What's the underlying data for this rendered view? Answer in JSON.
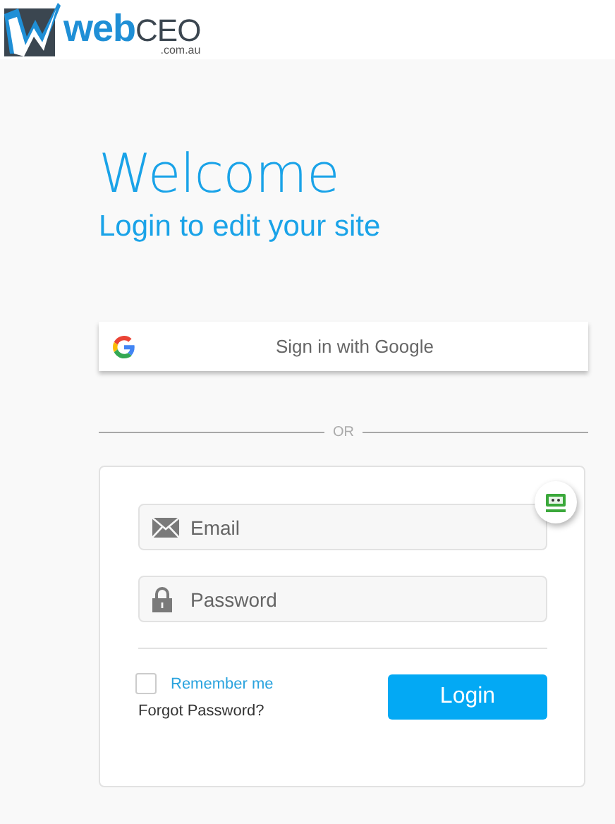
{
  "logo": {
    "brand_1": "web",
    "brand_2": "CEO",
    "domain": ".com.au"
  },
  "heading": "Welcome",
  "subheading": "Login to edit your site",
  "google_button": "Sign in with Google",
  "divider_text": "OR",
  "form": {
    "email": {
      "placeholder": "Email"
    },
    "password": {
      "placeholder": "Password"
    },
    "remember": {
      "label": "Remember me",
      "checked": false
    },
    "forgot_link": "Forgot Password?",
    "login_button": "Login"
  }
}
